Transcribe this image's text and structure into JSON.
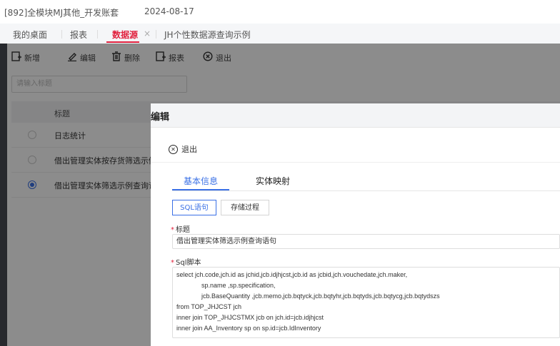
{
  "topbar": {
    "company": "[892]全模块MJ其他_开发账套",
    "date": "2024-08-17"
  },
  "tabs": [
    {
      "label": "我的桌面"
    },
    {
      "label": "报表"
    },
    {
      "label": "数据源",
      "close": "×"
    },
    {
      "label": "JH个性数据源查询示例"
    }
  ],
  "toolbar": [
    {
      "label": "新增",
      "icon": "add-icon"
    },
    {
      "label": "编辑",
      "icon": "edit-icon"
    },
    {
      "label": "删除",
      "icon": "delete-icon"
    },
    {
      "label": "报表",
      "icon": "report-icon"
    },
    {
      "label": "退出",
      "icon": "exit-icon"
    }
  ],
  "search": {
    "placeholder": "请输入标题"
  },
  "table": {
    "header": "标题",
    "rows": [
      {
        "title": "日志统计",
        "selected": false
      },
      {
        "title": "借出管理实体按存货筛选示例",
        "selected": false
      },
      {
        "title": "借出管理实体筛选示例查询语句",
        "selected": true
      }
    ]
  },
  "modal": {
    "title": "编辑",
    "exit": "退出",
    "tabs": [
      "基本信息",
      "实体映射"
    ],
    "segments": [
      "SQL语句",
      "存储过程"
    ],
    "title_label": "标题",
    "title_value": "借出管理实体筛选示例查询语句",
    "sql_label": "Sql脚本",
    "sql_lines": [
      "select jch.code,jch.id as jchid,jcb.idjhjcst,jcb.id as jcbid,jch.vouchedate,jch.maker,",
      "              sp.name ,sp.specification,",
      "              jcb.BaseQuantity ,jcb.memo,jcb.bqtyck,jcb.bqtyhr,jcb.bqtyds,jcb.bqtycg,jcb.bqtydszs",
      "from TOP_JHJCST jch",
      "inner join TOP_JHJCSTMX jcb on jch.id=jcb.idjhjcst",
      "inner join AA_Inventory sp on sp.id=jcb.IdInventory"
    ]
  }
}
